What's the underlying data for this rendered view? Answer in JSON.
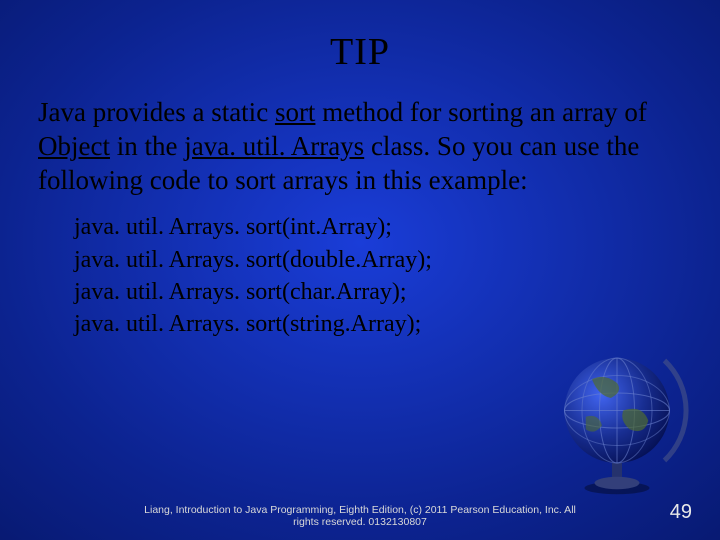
{
  "title": "TIP",
  "paragraph": {
    "p1a": "Java provides a static ",
    "p1b": "sort",
    "p1c": " method for sorting an array of ",
    "p1d": "Object",
    "p1e": " in the ",
    "p1f": "java. util. Arrays",
    "p1g": " class. So you can use the following code to sort arrays in this example:"
  },
  "code": {
    "l1": "java. util. Arrays. sort(int.Array);",
    "l2": "java. util. Arrays. sort(double.Array);",
    "l3": "java. util. Arrays. sort(char.Array);",
    "l4": "java. util. Arrays. sort(string.Array);"
  },
  "footer": {
    "line1": "Liang, Introduction to Java Programming, Eighth Edition, (c) 2011 Pearson Education, Inc. All",
    "line2": "rights reserved. 0132130807"
  },
  "page_number": "49"
}
